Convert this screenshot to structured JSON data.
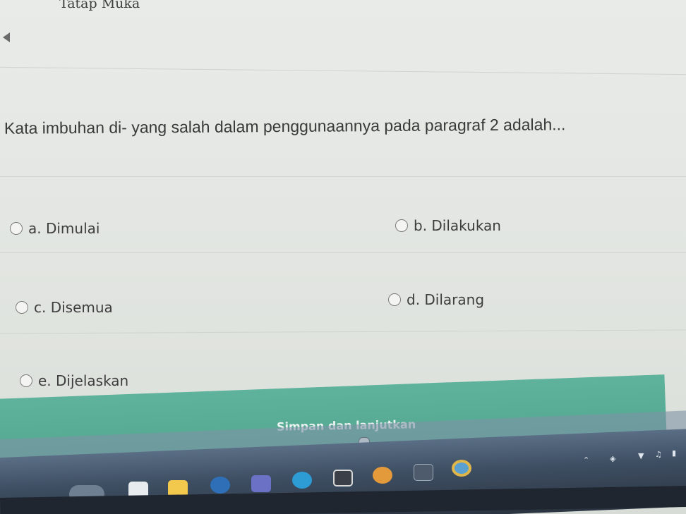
{
  "header": {
    "title": "Tatap Muka"
  },
  "question": {
    "text": "Kata imbuhan di- yang salah dalam penggunaannya pada paragraf 2 adalah..."
  },
  "options": [
    {
      "label": "a. Dimulai"
    },
    {
      "label": "b. Dilakukan"
    },
    {
      "label": "c. Disemua"
    },
    {
      "label": "d. Dilarang"
    },
    {
      "label": "e. Dijelaskan"
    }
  ],
  "submit": {
    "label": "Simpan dan lanjutkan",
    "color": "#58ad96"
  },
  "taskbar": {
    "icons": [
      "weather-icon",
      "taskview-icon",
      "file-explorer-icon",
      "edge-dev-icon",
      "teams-icon",
      "edge-icon",
      "store-icon",
      "app-icon",
      "app-icon-2",
      "chrome-icon"
    ]
  }
}
